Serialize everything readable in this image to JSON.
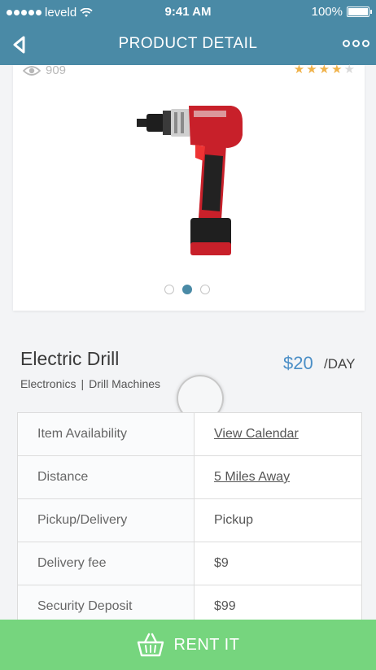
{
  "status_bar": {
    "carrier": "leveld",
    "time": "9:41 AM",
    "battery": "100%",
    "battery_level": 1.0
  },
  "nav": {
    "title": "PRODUCT DETAIL",
    "back_icon": "back-arrow-icon",
    "more_icon": "more-options-icon"
  },
  "card": {
    "views": "909",
    "rating": 4,
    "rating_max": 5,
    "star_color": "#f0b24a",
    "pager_count": 3,
    "pager_active": 1
  },
  "product": {
    "title": "Electric Drill",
    "category": "Electronics",
    "separator": "|",
    "subcategory": "Drill Machines",
    "price": "$20",
    "price_unit": "/DAY"
  },
  "details": [
    {
      "label": "Item Availability",
      "value": "View Calendar",
      "link": true
    },
    {
      "label": "Distance",
      "value": "5 Miles Away",
      "link": true
    },
    {
      "label": "Pickup/Delivery",
      "value": "Pickup",
      "link": false
    },
    {
      "label": "Delivery fee",
      "value": "$9",
      "link": false
    },
    {
      "label": "Security Deposit",
      "value": "$99",
      "link": false
    }
  ],
  "rent_button": {
    "label": "RENT IT",
    "icon": "basket-icon"
  },
  "colors": {
    "header": "#4a8aa6",
    "accent_price": "#4a8ec6",
    "button": "#76d57e"
  }
}
